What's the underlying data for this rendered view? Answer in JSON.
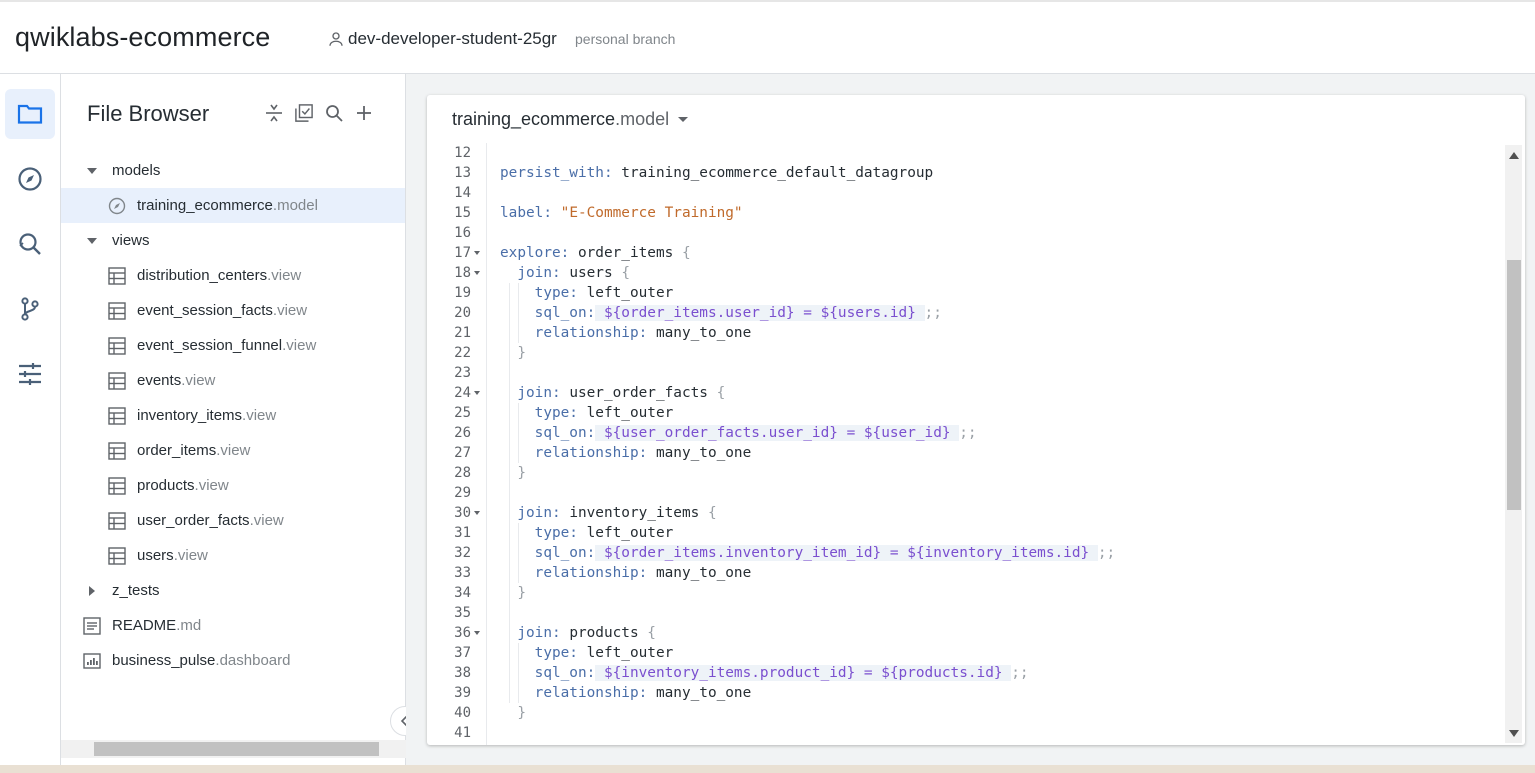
{
  "header": {
    "project_title": "qwiklabs-ecommerce",
    "user_name": "dev-developer-student-25gr",
    "branch_label": "personal branch"
  },
  "rail": {
    "items": [
      {
        "icon": "folder-icon",
        "active": true
      },
      {
        "icon": "explore-compass-icon",
        "active": false
      },
      {
        "icon": "search-find-icon",
        "active": false
      },
      {
        "icon": "git-branch-icon",
        "active": false
      },
      {
        "icon": "settings-sliders-icon",
        "active": false
      }
    ]
  },
  "file_browser": {
    "title": "File Browser",
    "tools": [
      "collapse-all-icon",
      "validate-icon",
      "search-icon",
      "add-icon"
    ],
    "tree": [
      {
        "name": "models",
        "ext": "",
        "kind": "folder",
        "expanded": true
      },
      {
        "name": "training_ecommerce",
        "ext": ".model",
        "kind": "model",
        "selected": true
      },
      {
        "name": "views",
        "ext": "",
        "kind": "folder",
        "expanded": true
      },
      {
        "name": "distribution_centers",
        "ext": ".view",
        "kind": "view"
      },
      {
        "name": "event_session_facts",
        "ext": ".view",
        "kind": "view"
      },
      {
        "name": "event_session_funnel",
        "ext": ".view",
        "kind": "view"
      },
      {
        "name": "events",
        "ext": ".view",
        "kind": "view"
      },
      {
        "name": "inventory_items",
        "ext": ".view",
        "kind": "view"
      },
      {
        "name": "order_items",
        "ext": ".view",
        "kind": "view"
      },
      {
        "name": "products",
        "ext": ".view",
        "kind": "view"
      },
      {
        "name": "user_order_facts",
        "ext": ".view",
        "kind": "view"
      },
      {
        "name": "users",
        "ext": ".view",
        "kind": "view"
      },
      {
        "name": "z_tests",
        "ext": "",
        "kind": "folder",
        "expanded": false
      },
      {
        "name": "README",
        "ext": ".md",
        "kind": "doc"
      },
      {
        "name": "business_pulse",
        "ext": ".dashboard",
        "kind": "dashboard"
      }
    ]
  },
  "editor": {
    "file_name": "training_ecommerce",
    "file_ext": ".model",
    "lines": [
      {
        "n": "12",
        "fold": false,
        "html": ""
      },
      {
        "n": "13",
        "fold": false,
        "html": "<span class=\"k\">persist_with:</span> training_ecommerce_default_datagroup"
      },
      {
        "n": "14",
        "fold": false,
        "html": ""
      },
      {
        "n": "15",
        "fold": false,
        "html": "<span class=\"k\">label:</span> <span class=\"s\">\"E-Commerce Training\"</span>"
      },
      {
        "n": "16",
        "fold": false,
        "html": ""
      },
      {
        "n": "17",
        "fold": true,
        "html": "<span class=\"k\">explore:</span> order_items <span class=\"p\">{</span>"
      },
      {
        "n": "18",
        "fold": true,
        "html": "  <span class=\"k\">join:</span> users <span class=\"p\">{</span>"
      },
      {
        "n": "19",
        "fold": false,
        "html": "    <span class=\"k\">type:</span> left_outer"
      },
      {
        "n": "20",
        "fold": false,
        "html": "    <span class=\"k\">sql_on:</span><span class=\"sql\"> ${order_items.user_id} = ${users.id} </span><span class=\"p\">;;</span>"
      },
      {
        "n": "21",
        "fold": false,
        "html": "    <span class=\"k\">relationship:</span> many_to_one"
      },
      {
        "n": "22",
        "fold": false,
        "html": "  <span class=\"p\">}</span>"
      },
      {
        "n": "23",
        "fold": false,
        "html": ""
      },
      {
        "n": "24",
        "fold": true,
        "html": "  <span class=\"k\">join:</span> user_order_facts <span class=\"p\">{</span>"
      },
      {
        "n": "25",
        "fold": false,
        "html": "    <span class=\"k\">type:</span> left_outer"
      },
      {
        "n": "26",
        "fold": false,
        "html": "    <span class=\"k\">sql_on:</span><span class=\"sql\"> ${user_order_facts.user_id} = ${user_id} </span><span class=\"p\">;;</span>"
      },
      {
        "n": "27",
        "fold": false,
        "html": "    <span class=\"k\">relationship:</span> many_to_one"
      },
      {
        "n": "28",
        "fold": false,
        "html": "  <span class=\"p\">}</span>"
      },
      {
        "n": "29",
        "fold": false,
        "html": ""
      },
      {
        "n": "30",
        "fold": true,
        "html": "  <span class=\"k\">join:</span> inventory_items <span class=\"p\">{</span>"
      },
      {
        "n": "31",
        "fold": false,
        "html": "    <span class=\"k\">type:</span> left_outer"
      },
      {
        "n": "32",
        "fold": false,
        "html": "    <span class=\"k\">sql_on:</span><span class=\"sql\"> ${order_items.inventory_item_id} = ${inventory_items.id} </span><span class=\"p\">;;</span>"
      },
      {
        "n": "33",
        "fold": false,
        "html": "    <span class=\"k\">relationship:</span> many_to_one"
      },
      {
        "n": "34",
        "fold": false,
        "html": "  <span class=\"p\">}</span>"
      },
      {
        "n": "35",
        "fold": false,
        "html": ""
      },
      {
        "n": "36",
        "fold": true,
        "html": "  <span class=\"k\">join:</span> products <span class=\"p\">{</span>"
      },
      {
        "n": "37",
        "fold": false,
        "html": "    <span class=\"k\">type:</span> left_outer"
      },
      {
        "n": "38",
        "fold": false,
        "html": "    <span class=\"k\">sql_on:</span><span class=\"sql\"> ${inventory_items.product_id} = ${products.id} </span><span class=\"p\">;;</span>"
      },
      {
        "n": "39",
        "fold": false,
        "html": "    <span class=\"k\">relationship:</span> many_to_one"
      },
      {
        "n": "40",
        "fold": false,
        "html": "  <span class=\"p\">}</span>"
      },
      {
        "n": "41",
        "fold": false,
        "html": ""
      }
    ]
  }
}
